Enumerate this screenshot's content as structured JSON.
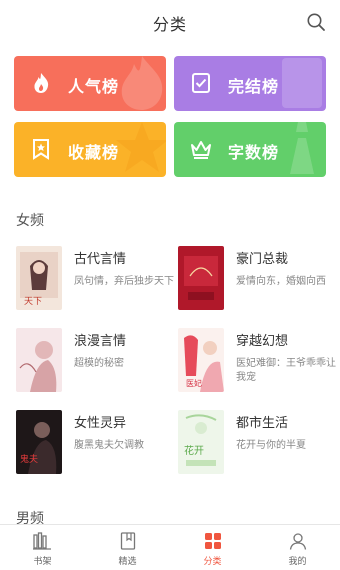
{
  "header": {
    "title": "分类",
    "search_icon": "search-icon"
  },
  "tiles": [
    {
      "label": "人气榜",
      "icon": "flame-icon",
      "color": "#f76f5b"
    },
    {
      "label": "完结榜",
      "icon": "checklist-icon",
      "color": "#a97de4"
    },
    {
      "label": "收藏榜",
      "icon": "bookmark-star-icon",
      "color": "#fbb228"
    },
    {
      "label": "字数榜",
      "icon": "crown-icon",
      "color": "#62cf6a"
    }
  ],
  "female": {
    "title": "女频",
    "categories": [
      {
        "name": "古代言情",
        "desc": "凤句情，弃后独步天下"
      },
      {
        "name": "豪门总裁",
        "desc": "爱情向东，婚姻向西"
      },
      {
        "name": "浪漫言情",
        "desc": "超模的秘密"
      },
      {
        "name": "穿越幻想",
        "desc": "医妃难御：王爷乖乖让我宠"
      },
      {
        "name": "女性灵异",
        "desc": "腹黑鬼夫欠调教"
      },
      {
        "name": "都市生活",
        "desc": "花开与你的半夏"
      }
    ]
  },
  "male": {
    "title": "男频"
  },
  "tabbar": {
    "items": [
      {
        "label": "书架",
        "icon": "bookshelf-icon"
      },
      {
        "label": "精选",
        "icon": "book-icon"
      },
      {
        "label": "分类",
        "icon": "category-grid-icon",
        "active": true
      },
      {
        "label": "我的",
        "icon": "user-icon"
      }
    ],
    "active_color": "#f0563f"
  }
}
